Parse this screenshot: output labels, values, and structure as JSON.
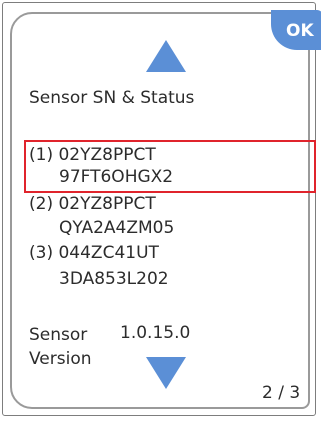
{
  "header": {
    "ok_label": "OK",
    "title": "Sensor SN & Status"
  },
  "sensors": [
    {
      "line1": "(1) 02YZ8PPCT",
      "line2": "97FT6OHGX2",
      "selected": true
    },
    {
      "line1": "(2) 02YZ8PPCT",
      "line2": "QYA2A4ZM05",
      "selected": false
    },
    {
      "line1": "(3) 044ZC41UT",
      "line2": "3DA853L202",
      "selected": false
    }
  ],
  "version": {
    "label_line1": "Sensor",
    "label_line2": "Version",
    "value": "1.0.15.0"
  },
  "pagination": {
    "text": "2 / 3"
  },
  "colors": {
    "accent": "#5b8fd6",
    "selection_border": "#e0242c"
  },
  "icons": {
    "scroll_up": "arrow-up-icon",
    "scroll_down": "arrow-down-icon"
  }
}
